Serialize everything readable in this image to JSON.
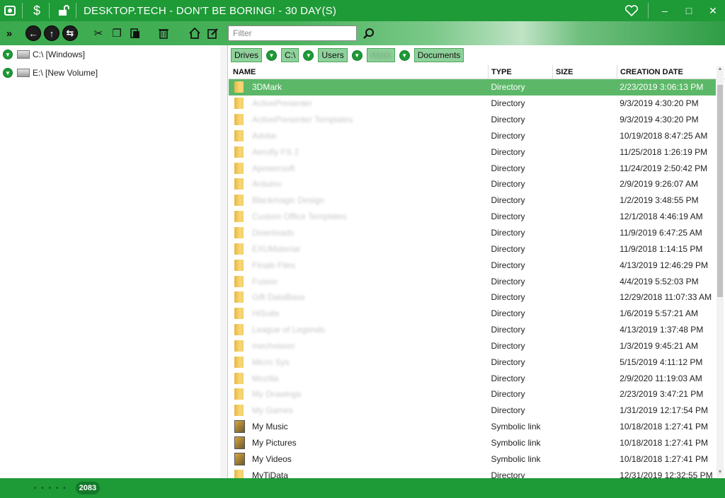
{
  "title": "DESKTOP.TECH - DON'T BE BORING! - 30 DAY(S)",
  "titlebar_icons": [
    "app-logo-icon",
    "dollar-icon",
    "unlock-icon"
  ],
  "window_controls": {
    "favorite": "♡",
    "minimize": "–",
    "maximize": "□",
    "close": "✕"
  },
  "toolbar": {
    "expand": "»",
    "back": "←",
    "up": "↑",
    "refresh": "⇆",
    "cut": "✂",
    "copy": "❐",
    "paste": "📋",
    "delete": "🗑",
    "home": "⌂",
    "edit": "✎",
    "filter_placeholder": "Filter",
    "search": "⌕"
  },
  "tree": [
    {
      "label": "C:\\ [Windows]"
    },
    {
      "label": "E:\\ [New Volume]"
    }
  ],
  "breadcrumbs": [
    {
      "label": "Drives",
      "blurred": false
    },
    {
      "label": "C:\\",
      "blurred": false
    },
    {
      "label": "Users",
      "blurred": false
    },
    {
      "label": "Mario",
      "blurred": true
    },
    {
      "label": "Documents",
      "blurred": false
    }
  ],
  "columns": {
    "name": "NAME",
    "type": "TYPE",
    "size": "SIZE",
    "date": "CREATION DATE"
  },
  "rows": [
    {
      "name": "3DMark",
      "type": "Directory",
      "size": "",
      "date": "2/23/2019 3:06:13 PM",
      "blur": false,
      "icon": "folder",
      "selected": true
    },
    {
      "name": "ActivePresenter",
      "type": "Directory",
      "size": "",
      "date": "9/3/2019 4:30:20 PM",
      "blur": true,
      "icon": "folder"
    },
    {
      "name": "ActivePresenter Templates",
      "type": "Directory",
      "size": "",
      "date": "9/3/2019 4:30:20 PM",
      "blur": true,
      "icon": "folder"
    },
    {
      "name": "Adobe",
      "type": "Directory",
      "size": "",
      "date": "10/19/2018 8:47:25 AM",
      "blur": true,
      "icon": "folder"
    },
    {
      "name": "Aerofly FS 2",
      "type": "Directory",
      "size": "",
      "date": "11/25/2018 1:26:19 PM",
      "blur": true,
      "icon": "folder"
    },
    {
      "name": "Apowersoft",
      "type": "Directory",
      "size": "",
      "date": "11/24/2019 2:50:42 PM",
      "blur": true,
      "icon": "folder"
    },
    {
      "name": "Arduino",
      "type": "Directory",
      "size": "",
      "date": "2/9/2019 9:26:07 AM",
      "blur": true,
      "icon": "folder"
    },
    {
      "name": "Blackmagic Design",
      "type": "Directory",
      "size": "",
      "date": "1/2/2019 3:48:55 PM",
      "blur": true,
      "icon": "folder"
    },
    {
      "name": "Custom Office Templates",
      "type": "Directory",
      "size": "",
      "date": "12/1/2018 4:46:19 AM",
      "blur": true,
      "icon": "folder"
    },
    {
      "name": "Downloads",
      "type": "Directory",
      "size": "",
      "date": "11/9/2019 6:47:25 AM",
      "blur": true,
      "icon": "folder"
    },
    {
      "name": "EXUMaterial",
      "type": "Directory",
      "size": "",
      "date": "11/9/2018 1:14:15 PM",
      "blur": true,
      "icon": "folder"
    },
    {
      "name": "Finale Files",
      "type": "Directory",
      "size": "",
      "date": "4/13/2019 12:46:29 PM",
      "blur": true,
      "icon": "folder"
    },
    {
      "name": "Fusion",
      "type": "Directory",
      "size": "",
      "date": "4/4/2019 5:52:03 PM",
      "blur": true,
      "icon": "folder"
    },
    {
      "name": "Gift DataBase",
      "type": "Directory",
      "size": "",
      "date": "12/29/2018 11:07:33 AM",
      "blur": true,
      "icon": "folder"
    },
    {
      "name": "HiSuite",
      "type": "Directory",
      "size": "",
      "date": "1/6/2019 5:57:21 AM",
      "blur": true,
      "icon": "folder"
    },
    {
      "name": "League of Legends",
      "type": "Directory",
      "size": "",
      "date": "4/13/2019 1:37:48 PM",
      "blur": true,
      "icon": "folder"
    },
    {
      "name": "mechvision",
      "type": "Directory",
      "size": "",
      "date": "1/3/2019 9:45:21 AM",
      "blur": true,
      "icon": "folder"
    },
    {
      "name": "Micro Sys",
      "type": "Directory",
      "size": "",
      "date": "5/15/2019 4:11:12 PM",
      "blur": true,
      "icon": "folder"
    },
    {
      "name": "Mozilla",
      "type": "Directory",
      "size": "",
      "date": "2/9/2020 11:19:03 AM",
      "blur": true,
      "icon": "folder"
    },
    {
      "name": "My Drawings",
      "type": "Directory",
      "size": "",
      "date": "2/23/2019 3:47:21 PM",
      "blur": true,
      "icon": "folder"
    },
    {
      "name": "My Games",
      "type": "Directory",
      "size": "",
      "date": "1/31/2019 12:17:54 PM",
      "blur": true,
      "icon": "folder"
    },
    {
      "name": "My Music",
      "type": "Symbolic link",
      "size": "",
      "date": "10/18/2018 1:27:41 PM",
      "blur": false,
      "icon": "link"
    },
    {
      "name": "My Pictures",
      "type": "Symbolic link",
      "size": "",
      "date": "10/18/2018 1:27:41 PM",
      "blur": false,
      "icon": "link"
    },
    {
      "name": "My Videos",
      "type": "Symbolic link",
      "size": "",
      "date": "10/18/2018 1:27:41 PM",
      "blur": false,
      "icon": "link"
    },
    {
      "name": "MyTiData",
      "type": "Directory",
      "size": "",
      "date": "12/31/2019 12:32:55 PM",
      "blur": false,
      "icon": "folder"
    }
  ],
  "status": {
    "dots": "• • • • •",
    "count": "2083"
  },
  "colors": {
    "accent": "#1e9a37",
    "selection": "#5cb868",
    "crumb_bg": "#8fd19b"
  }
}
